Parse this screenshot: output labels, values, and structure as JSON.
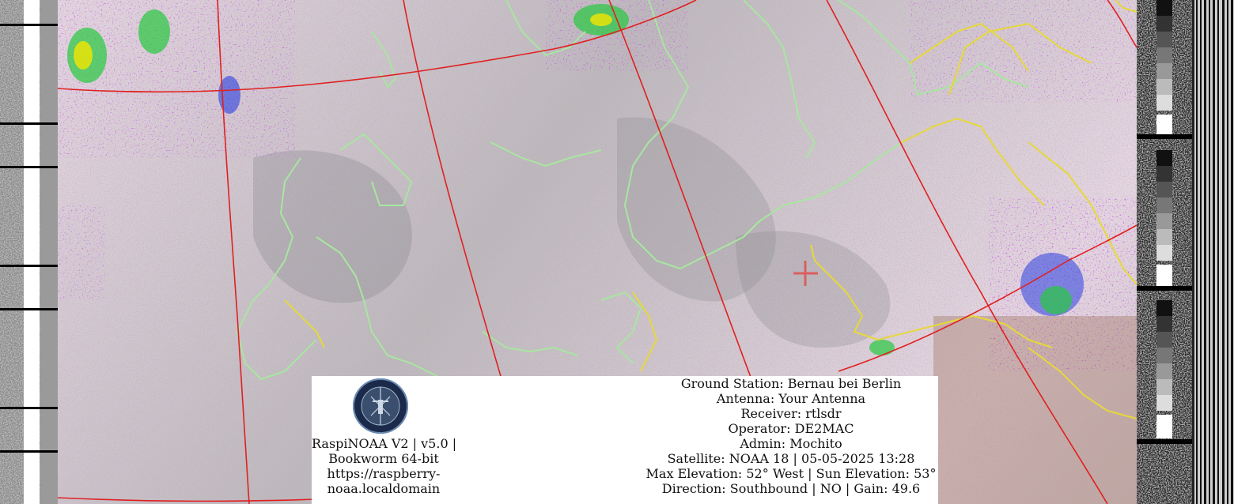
{
  "overlay": {
    "software_line": "RaspiNOAA V2 | v5.0 |",
    "os_line": "Bookworm 64-bit",
    "url_line_1": "https://raspberry-",
    "url_line_2": "noaa.localdomain",
    "ground_station": "Ground Station: Bernau bei Berlin",
    "antenna": "Antenna: Your Antenna",
    "receiver": "Receiver: rtlsdr",
    "operator": "Operator: DE2MAC",
    "admin": "Admin: Mochito",
    "satellite": "Satellite: NOAA 18 | 05-05-2025 13:28",
    "elevation": "Max Elevation: 52° West | Sun Elevation: 53°",
    "direction": "Direction: Southbound | NO | Gain: 49.6"
  },
  "logo": {
    "name": "raspberry-noaa-logo"
  },
  "map_colors": {
    "coastline": "#a8e6a0",
    "border": "#e6d83a",
    "graticule": "#e02020",
    "ground_station_marker": "#e05050"
  }
}
